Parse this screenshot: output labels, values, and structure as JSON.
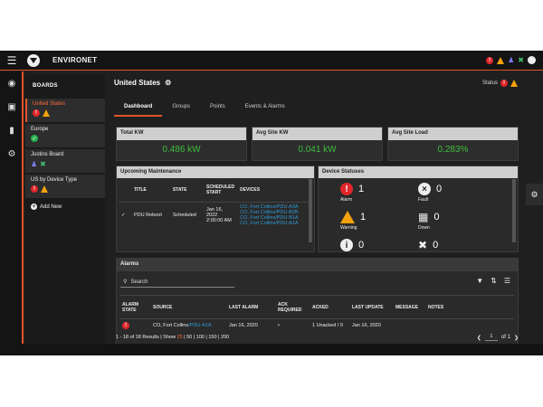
{
  "app": {
    "brand": "ENVIRONET"
  },
  "boards": {
    "header": "BOARDS",
    "items": [
      {
        "name": "United States",
        "status": [
          "alarm",
          "warning"
        ]
      },
      {
        "name": "Europe",
        "status": [
          "normal"
        ]
      },
      {
        "name": "Justins Board",
        "status": [
          "person",
          "tool"
        ]
      },
      {
        "name": "US by Device Type",
        "status": [
          "alarm",
          "warning"
        ]
      }
    ],
    "add_label": "Add New"
  },
  "site": {
    "title": "United States",
    "status_label": "Status"
  },
  "tabs": [
    "Dashboard",
    "Groups",
    "Points",
    "Events & Alarms"
  ],
  "kpis": [
    {
      "label": "Total KW",
      "value": "0.486 kW"
    },
    {
      "label": "Avg Site KW",
      "value": "0.041 kW"
    },
    {
      "label": "Avg Site Load",
      "value": "0.283%"
    }
  ],
  "maintenance": {
    "title": "Upcoming Maintenance",
    "columns": [
      "TITLE",
      "STATE",
      "SCHEDULED START",
      "DEVICES"
    ],
    "row": {
      "title": "PDU Reboot",
      "state": "Scheduled",
      "date": "Jan 16, 2022",
      "time": "2:00:00 AM",
      "devices": [
        "CO, Fort Collins/PDU-A3A",
        "CO, Fort Collins/PDU-B2B",
        "CO, Fort Collins/PDU-B1A",
        "CO, Fort Collins/PDU-A1A"
      ]
    }
  },
  "device_statuses": {
    "title": "Device Statuses",
    "items": [
      {
        "label": "Alarm",
        "count": "1"
      },
      {
        "label": "Fault",
        "count": "0"
      },
      {
        "label": "Warning",
        "count": "1"
      },
      {
        "label": "Down",
        "count": "0"
      },
      {
        "label": "",
        "count": "0"
      },
      {
        "label": "",
        "count": "0"
      }
    ]
  },
  "alarms": {
    "title": "Alarms",
    "search_placeholder": "Search",
    "columns": [
      "ALARM STATE",
      "SOURCE",
      "LAST ALARM",
      "ACK REQUIRED",
      "ACKED",
      "LAST UPDATE",
      "MESSAGE",
      "NOTES"
    ],
    "row": {
      "source": "CO, Fort Collins",
      "source_link": "/PDU-A1A",
      "last_alarm": "Jan 16, 2020",
      "ack_required": "•",
      "acked": "1 Unacked / 0",
      "last_update": "Jan 16, 2020",
      "message": "",
      "notes": ""
    }
  },
  "footer": {
    "results": "1 - 18 of 18 Results | Show",
    "show_current": "25",
    "show_options": "| 50 | 100 | 150 | 200",
    "page": "1",
    "of": "of 1"
  },
  "colors": {
    "accent": "#e0542a",
    "alarm": "#e0262b",
    "warning": "#f2a20d",
    "ok": "#27b04b",
    "value_green": "#3fbf3f",
    "link": "#2d9bd8"
  }
}
